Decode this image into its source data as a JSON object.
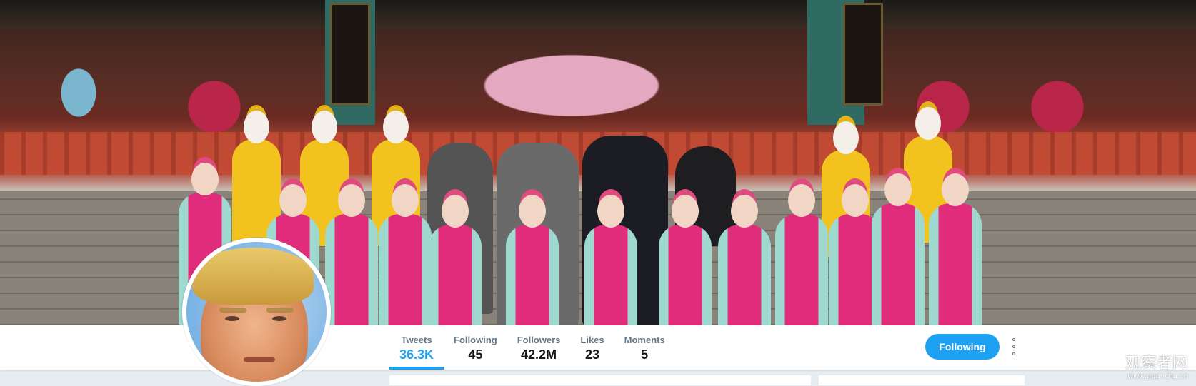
{
  "profile": {
    "banner_icon": "header-photo",
    "avatar_icon": "profile-photo"
  },
  "nav": {
    "stats": [
      {
        "label": "Tweets",
        "value": "36.3K",
        "active": true
      },
      {
        "label": "Following",
        "value": "45"
      },
      {
        "label": "Followers",
        "value": "42.2M"
      },
      {
        "label": "Likes",
        "value": "23"
      },
      {
        "label": "Moments",
        "value": "5"
      }
    ],
    "follow_button": "Following",
    "more_icon": "more-vertical-icon"
  },
  "watermark": {
    "main": "观察者网",
    "sub": "www.guancha.cn"
  },
  "colors": {
    "accent": "#1da1f2",
    "label": "#657786",
    "value": "#14171a",
    "page_bg": "#e6ecf0"
  }
}
